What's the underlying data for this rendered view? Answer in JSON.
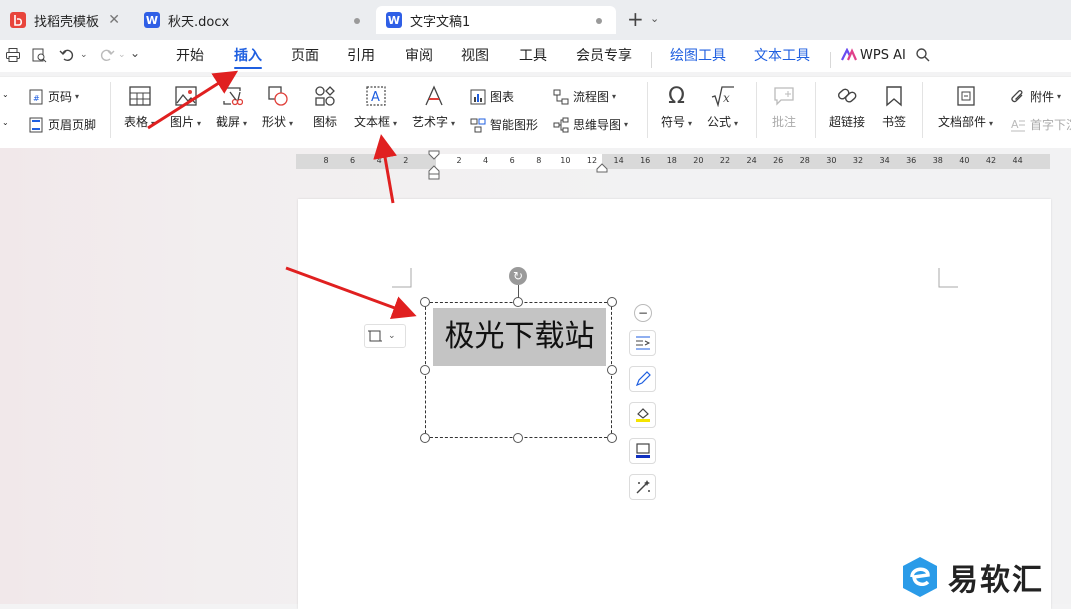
{
  "tabs": [
    {
      "label": "找稻壳模板",
      "icon": "daoke-logo-icon",
      "close": "✕"
    },
    {
      "label": "秋天.docx",
      "icon": "wps-writer-icon"
    },
    {
      "label": "文字文稿1",
      "icon": "wps-writer-icon"
    }
  ],
  "tab_add": "+",
  "menu": {
    "items": [
      "开始",
      "插入",
      "页面",
      "引用",
      "审阅",
      "视图",
      "工具",
      "会员专享"
    ],
    "context": [
      "绘图工具",
      "文本工具"
    ],
    "wps_ai": "WPS AI",
    "active": "插入"
  },
  "ribbon": {
    "left_small": {
      "page_number": "页码",
      "header_footer": "页眉页脚"
    },
    "table": "表格",
    "picture": "图片",
    "screenshot": "截屏",
    "shape": "形状",
    "icon": "图标",
    "textbox": "文本框",
    "wordart": "艺术字",
    "chart": "图表",
    "smart_art": "智能图形",
    "flowchart": "流程图",
    "mindmap": "思维导图",
    "symbol": "符号",
    "formula": "公式",
    "comment": "批注",
    "hyperlink": "超链接",
    "bookmark": "书签",
    "doc_parts": "文档部件",
    "attachment": "附件",
    "drop_cap": "首字下沉"
  },
  "ruler": {
    "ticks": [
      "8",
      "6",
      "4",
      "2",
      "",
      "2",
      "4",
      "6",
      "8",
      "10",
      "12",
      "14",
      "16",
      "18",
      "20",
      "22",
      "24",
      "26",
      "28",
      "30",
      "32",
      "34",
      "36",
      "38",
      "40",
      "42",
      "44"
    ]
  },
  "document": {
    "textbox_text": "极光下载站"
  },
  "watermark": {
    "text": "易软汇"
  },
  "colors": {
    "accent": "#1f5fe0",
    "arrow": "#e02020",
    "selection": "#c4c4c4",
    "watermark_blue": "#2a9be8"
  }
}
